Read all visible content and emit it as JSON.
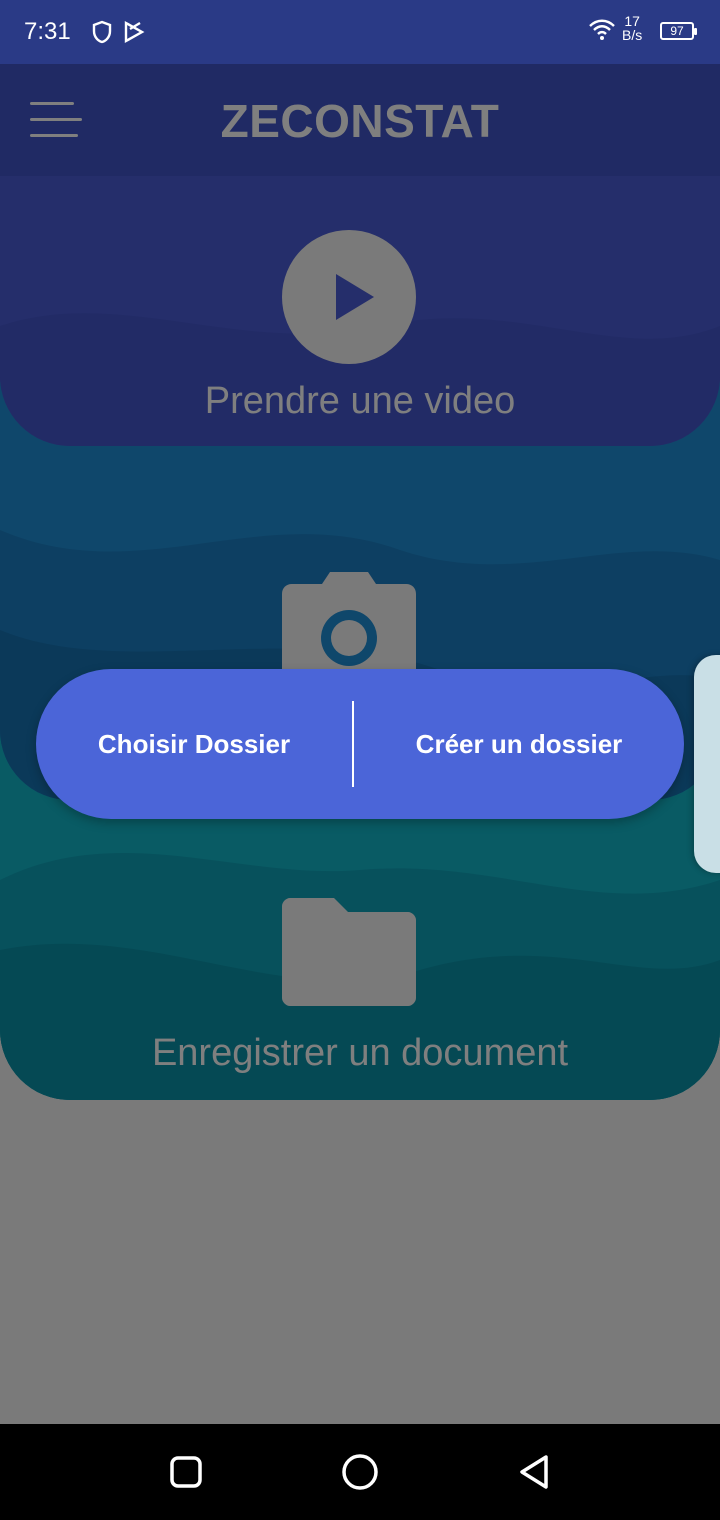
{
  "status_bar": {
    "time": "7:31",
    "icons": [
      "shield-icon",
      "play-store-icon"
    ],
    "right_icons": [
      "wifi-icon",
      "battery-icon"
    ],
    "net_speed_value": "17",
    "net_speed_unit": "B/s",
    "battery_level": "97"
  },
  "app_bar": {
    "title": "ZECONSTAT",
    "menu_icon": "menu-icon"
  },
  "cards": {
    "video": {
      "label": "Prendre une video",
      "icon": "play-icon"
    },
    "photo": {
      "icon": "camera-icon"
    },
    "document": {
      "label": "Enregistrer un document",
      "icon": "folder-icon"
    }
  },
  "dialog": {
    "choose_label": "Choisir Dossier",
    "create_label": "Créer un dossier"
  },
  "nav_bar": {
    "buttons": [
      "recents-icon",
      "home-icon",
      "back-icon"
    ]
  },
  "colors": {
    "status_bar": "#2a3a86",
    "app_bar": "#4154c8",
    "video_card": "#4a5cd6",
    "photo_card": "#1f8fd6",
    "document_card": "#12b6c8",
    "dialog": "#4b65d8",
    "scrim": "rgba(0,0,0,0.5)"
  }
}
